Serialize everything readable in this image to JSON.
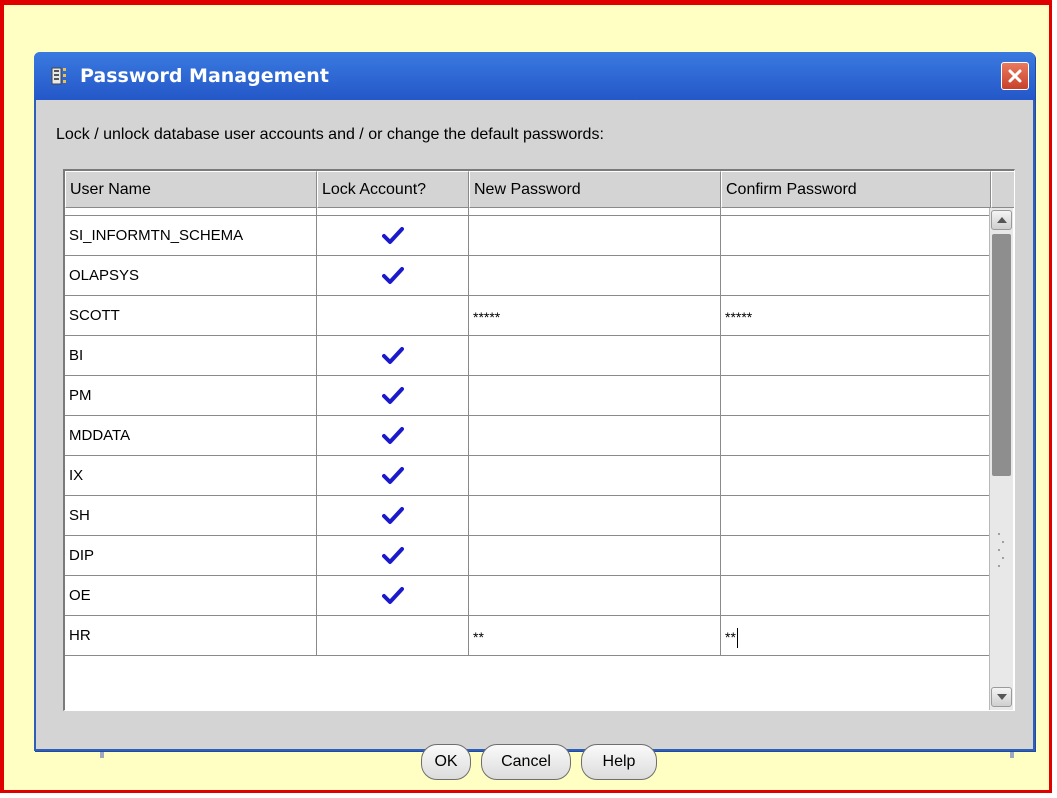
{
  "dialog": {
    "title": "Password Management",
    "app_icon": "oracle-dialog-icon",
    "close_icon": "close-icon",
    "instruction": "Lock / unlock database user accounts and / or change the default passwords:"
  },
  "table": {
    "headers": [
      "User Name",
      "Lock Account?",
      "New Password",
      "Confirm Password"
    ],
    "rows": [
      {
        "user": "SI_INFORMTN_SCHEMA",
        "locked": true,
        "new_password": "",
        "confirm_password": ""
      },
      {
        "user": "OLAPSYS",
        "locked": true,
        "new_password": "",
        "confirm_password": ""
      },
      {
        "user": "SCOTT",
        "locked": false,
        "new_password": "*****",
        "confirm_password": "*****"
      },
      {
        "user": "BI",
        "locked": true,
        "new_password": "",
        "confirm_password": ""
      },
      {
        "user": "PM",
        "locked": true,
        "new_password": "",
        "confirm_password": ""
      },
      {
        "user": "MDDATA",
        "locked": true,
        "new_password": "",
        "confirm_password": ""
      },
      {
        "user": "IX",
        "locked": true,
        "new_password": "",
        "confirm_password": ""
      },
      {
        "user": "SH",
        "locked": true,
        "new_password": "",
        "confirm_password": ""
      },
      {
        "user": "DIP",
        "locked": true,
        "new_password": "",
        "confirm_password": ""
      },
      {
        "user": "OE",
        "locked": true,
        "new_password": "",
        "confirm_password": ""
      },
      {
        "user": "HR",
        "locked": false,
        "new_password": "**",
        "confirm_password": "**"
      }
    ],
    "check_icon": "checkmark-icon",
    "check_color": "#1a1acc"
  },
  "buttons": {
    "ok": "OK",
    "cancel": "Cancel",
    "help": "Help"
  },
  "colors": {
    "background": "#ffffc4",
    "frame_border": "#e00000",
    "titlebar": "#2457c8"
  }
}
